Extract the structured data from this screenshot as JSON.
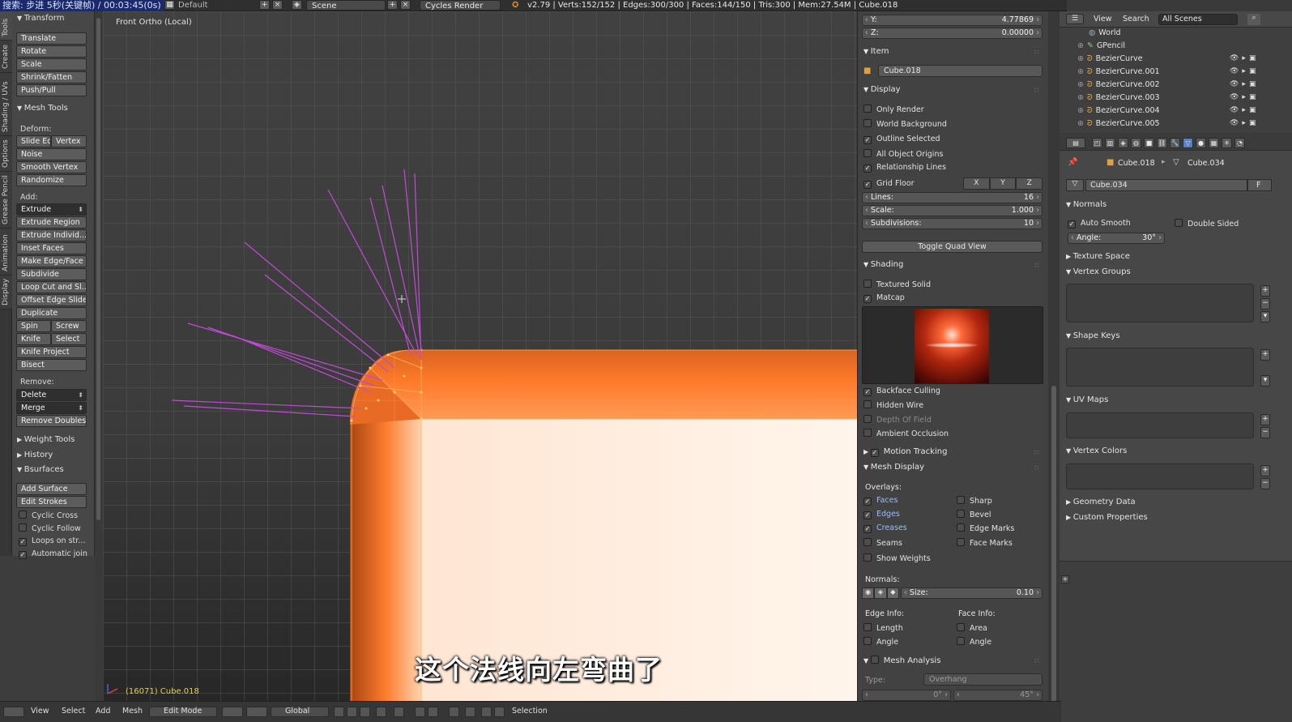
{
  "watermark": "搜索: 步进 5秒(关键帧) / 00:03:45(0s)",
  "topbar": {
    "layout_name": "Default",
    "scene_name": "Scene",
    "render_engine": "Cycles Render",
    "stats": "v2.79 | Verts:152/152 | Edges:300/300 | Faces:144/150 | Tris:300 | Mem:27.54M | Cube.018"
  },
  "vertical_tabs": [
    "Tools",
    "Create",
    "Shading / UVs",
    "Options",
    "Grease Pencil",
    "Animation",
    "Display"
  ],
  "toolshelf": {
    "transform_header": "Transform",
    "transform_buttons": [
      "Translate",
      "Rotate",
      "Scale",
      "Shrink/Fatten",
      "Push/Pull"
    ],
    "mesh_tools_header": "Mesh Tools",
    "deform_label": "Deform:",
    "slide_edge": "Slide Ed",
    "vertex": "Vertex",
    "noise": "Noise",
    "smooth_vertex": "Smooth Vertex",
    "randomize": "Randomize",
    "add_label": "Add:",
    "extrude": "Extrude",
    "extrude_region": "Extrude Region",
    "extrude_individual": "Extrude Individ...",
    "inset_faces": "Inset Faces",
    "make_edge_face": "Make Edge/Face",
    "subdivide": "Subdivide",
    "loop_cut": "Loop Cut and Sl...",
    "offset_edge_slide": "Offset Edge Slide",
    "duplicate": "Duplicate",
    "spin": "Spin",
    "screw": "Screw",
    "knife": "Knife",
    "select": "Select",
    "knife_project": "Knife Project",
    "bisect": "Bisect",
    "remove_label": "Remove:",
    "delete": "Delete",
    "merge": "Merge",
    "remove_doubles": "Remove Doubles",
    "weight_tools": "Weight Tools",
    "history": "History",
    "bsurfaces": "Bsurfaces",
    "add_surface": "Add Surface",
    "edit_strokes": "Edit Strokes",
    "cyclic_cross": "Cyclic Cross",
    "cyclic_follow": "Cyclic Follow",
    "loops_on_strokes": "Loops on str...",
    "automatic_join": "Automatic join"
  },
  "viewport": {
    "view_label": "Front Ortho (Local)",
    "object_label": "(16071) Cube.018",
    "subtitle": "这个法线向左弯曲了"
  },
  "npanel": {
    "y_label": "Y:",
    "y_value": "4.77869",
    "z_label": "Z:",
    "z_value": "0.00000",
    "item_header": "Item",
    "item_name": "Cube.018",
    "display_header": "Display",
    "only_render": "Only Render",
    "world_background": "World Background",
    "outline_selected": "Outline Selected",
    "all_object_origins": "All Object Origins",
    "relationship_lines": "Relationship Lines",
    "grid_floor": "Grid Floor",
    "axis_x": "X",
    "axis_y": "Y",
    "axis_z": "Z",
    "lines_label": "Lines:",
    "lines_value": "16",
    "scale_label": "Scale:",
    "scale_value": "1.000",
    "subdivisions_label": "Subdivisions:",
    "subdivisions_value": "10",
    "toggle_quad_view": "Toggle Quad View",
    "shading_header": "Shading",
    "textured_solid": "Textured Solid",
    "matcap": "Matcap",
    "backface_culling": "Backface Culling",
    "hidden_wire": "Hidden Wire",
    "depth_of_field": "Depth Of Field",
    "ambient_occlusion": "Ambient Occlusion",
    "motion_tracking": "Motion Tracking",
    "mesh_display": "Mesh Display",
    "overlays_label": "Overlays:",
    "faces": "Faces",
    "sharp": "Sharp",
    "edges": "Edges",
    "bevel": "Bevel",
    "creases": "Creases",
    "edge_marks": "Edge Marks",
    "seams": "Seams",
    "face_marks": "Face Marks",
    "show_weights": "Show Weights",
    "normals_label": "Normals:",
    "size_label": "Size:",
    "size_value": "0.10",
    "edge_info": "Edge Info:",
    "face_info": "Face Info:",
    "length": "Length",
    "area": "Area",
    "angle": "Angle",
    "angle2": "Angle",
    "mesh_analysis": "Mesh Analysis",
    "type_label": "Type:",
    "type_value": "Overhang",
    "min_angle": "0°",
    "max_angle": "45°"
  },
  "outliner": {
    "view": "View",
    "search": "Search",
    "scene_filter": "All Scenes",
    "items": [
      "World",
      "GPencil",
      "BezierCurve",
      "BezierCurve.001",
      "BezierCurve.002",
      "BezierCurve.003",
      "BezierCurve.004",
      "BezierCurve.005"
    ]
  },
  "properties": {
    "object_name": "Cube.018",
    "mesh_name": "Cube.034",
    "datablock_name": "Cube.034",
    "fake_user": "F",
    "normals": "Normals",
    "auto_smooth": "Auto Smooth",
    "double_sided": "Double Sided",
    "angle_label": "Angle:",
    "angle_value": "30°",
    "texture_space": "Texture Space",
    "vertex_groups": "Vertex Groups",
    "shape_keys": "Shape Keys",
    "uv_maps": "UV Maps",
    "vertex_colors": "Vertex Colors",
    "geometry_data": "Geometry Data",
    "custom_properties": "Custom Properties"
  },
  "bottombar": {
    "view": "View",
    "select": "Select",
    "add": "Add",
    "mesh": "Mesh",
    "mode": "Edit Mode",
    "orientation": "Global",
    "selection": "Selection"
  },
  "colors": {
    "mesh_orange": "#ff7a2a",
    "normals_magenta": "#c24bd6",
    "selected_blue": "#5680c2",
    "object_label_yellow": "#e8d04a"
  }
}
